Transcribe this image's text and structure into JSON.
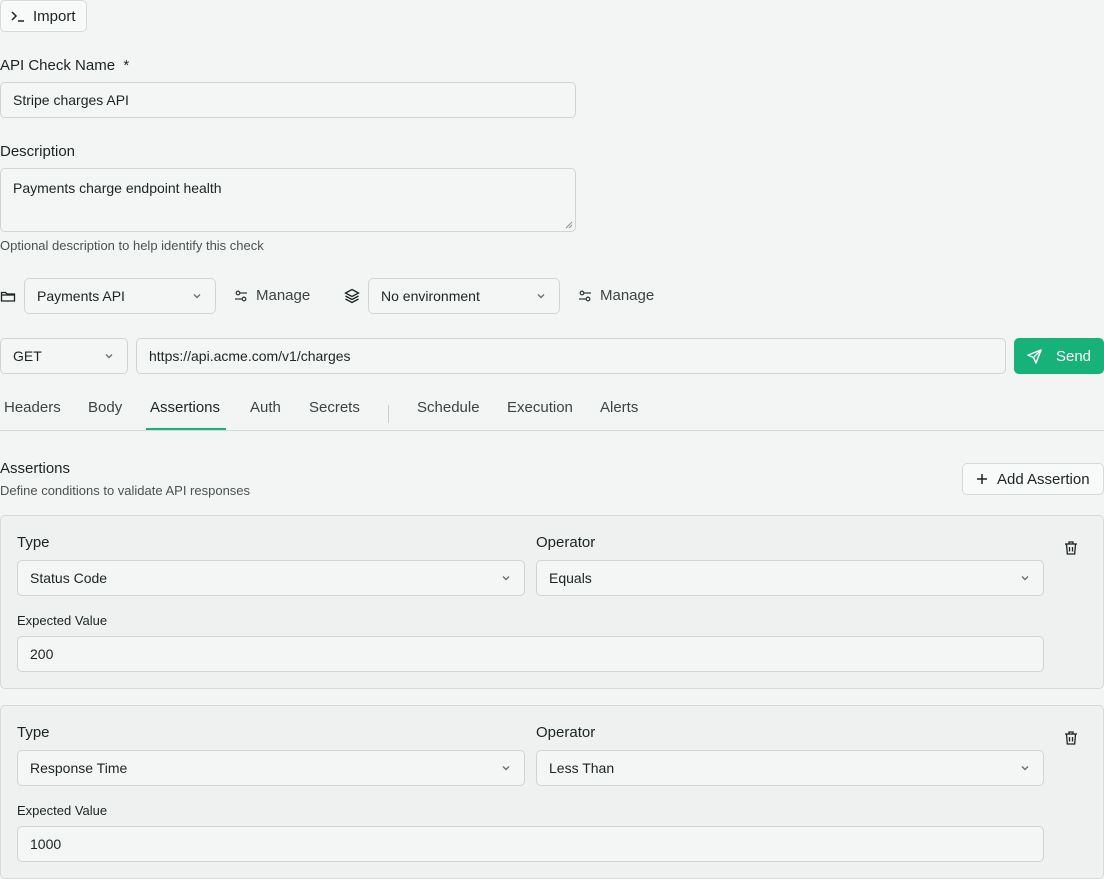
{
  "import_label": "Import",
  "name": {
    "label": "API Check Name",
    "required_mark": "*",
    "value": "Stripe charges API"
  },
  "description": {
    "label": "Description",
    "value": "Payments charge endpoint health",
    "hint": "Optional description to help identify this check"
  },
  "collection": {
    "selected": "Payments API",
    "manage_label": "Manage"
  },
  "environment": {
    "selected": "No environment",
    "manage_label": "Manage"
  },
  "request": {
    "method": "GET",
    "url": "https://api.acme.com/v1/charges",
    "send_label": "Send"
  },
  "tabs": [
    {
      "label": "Headers"
    },
    {
      "label": "Body"
    },
    {
      "label": "Assertions"
    },
    {
      "label": "Auth"
    },
    {
      "label": "Secrets"
    },
    {
      "label": "Schedule"
    },
    {
      "label": "Execution"
    },
    {
      "label": "Alerts"
    }
  ],
  "active_tab": "Assertions",
  "assertions": {
    "title": "Assertions",
    "subtitle": "Define conditions to validate API responses",
    "add_label": "Add Assertion",
    "items": [
      {
        "type_label": "Type",
        "type": "Status Code",
        "operator_label": "Operator",
        "operator": "Equals",
        "expected_label": "Expected Value",
        "expected": "200"
      },
      {
        "type_label": "Type",
        "type": "Response Time",
        "operator_label": "Operator",
        "operator": "Less Than",
        "expected_label": "Expected Value",
        "expected": "1000"
      }
    ]
  },
  "colors": {
    "accent": "#17b17a",
    "background": "#f3f5f4"
  }
}
